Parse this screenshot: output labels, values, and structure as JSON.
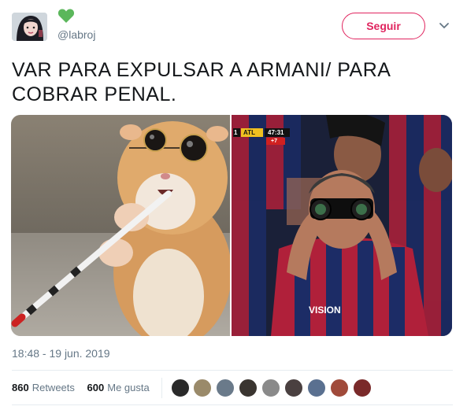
{
  "user": {
    "handle": "@labroj"
  },
  "follow_button": {
    "label": "Seguir"
  },
  "tweet": {
    "text": "VAR PARA EXPULSAR A ARMANI/ PARA COBRAR PENAL.",
    "timestamp": "18:48 - 19 jun. 2019"
  },
  "stats": {
    "retweets_count": "860",
    "retweets_label": "Retweets",
    "likes_count": "600",
    "likes_label": "Me gusta"
  },
  "scoreboard": {
    "team": "ATL",
    "clock": "47:31",
    "extra": "+7",
    "score": "1"
  },
  "colors": {
    "accent": "#e0245e",
    "heart": "#5bb75b",
    "muted": "#657786"
  },
  "icons": {
    "heart": "green-heart-icon",
    "chevron": "chevron-down-icon"
  }
}
